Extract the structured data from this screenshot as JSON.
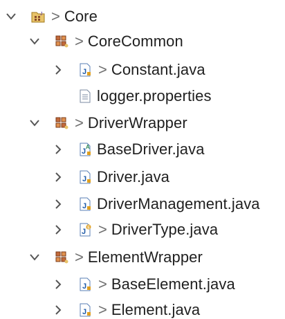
{
  "tree": {
    "project": {
      "label": "Core",
      "dirty": ">"
    },
    "packages": [
      {
        "label": "CoreCommon",
        "dirty": ">",
        "files": [
          {
            "label": "Constant.java",
            "dirty": ">"
          },
          {
            "label": "logger.properties",
            "dirty": ""
          }
        ]
      },
      {
        "label": "DriverWrapper",
        "dirty": ">",
        "files": [
          {
            "label": "BaseDriver.java",
            "dirty": ""
          },
          {
            "label": "Driver.java",
            "dirty": ""
          },
          {
            "label": "DriverManagement.java",
            "dirty": ""
          },
          {
            "label": "DriverType.java",
            "dirty": ">"
          }
        ]
      },
      {
        "label": "ElementWrapper",
        "dirty": ">",
        "files": [
          {
            "label": "BaseElement.java",
            "dirty": ">"
          },
          {
            "label": "Element.java",
            "dirty": ">"
          }
        ]
      }
    ]
  },
  "colors": {
    "chevron": "#555555",
    "package": "#a0522d",
    "java_file": "#1e5aa8",
    "dirty": "#707070"
  }
}
